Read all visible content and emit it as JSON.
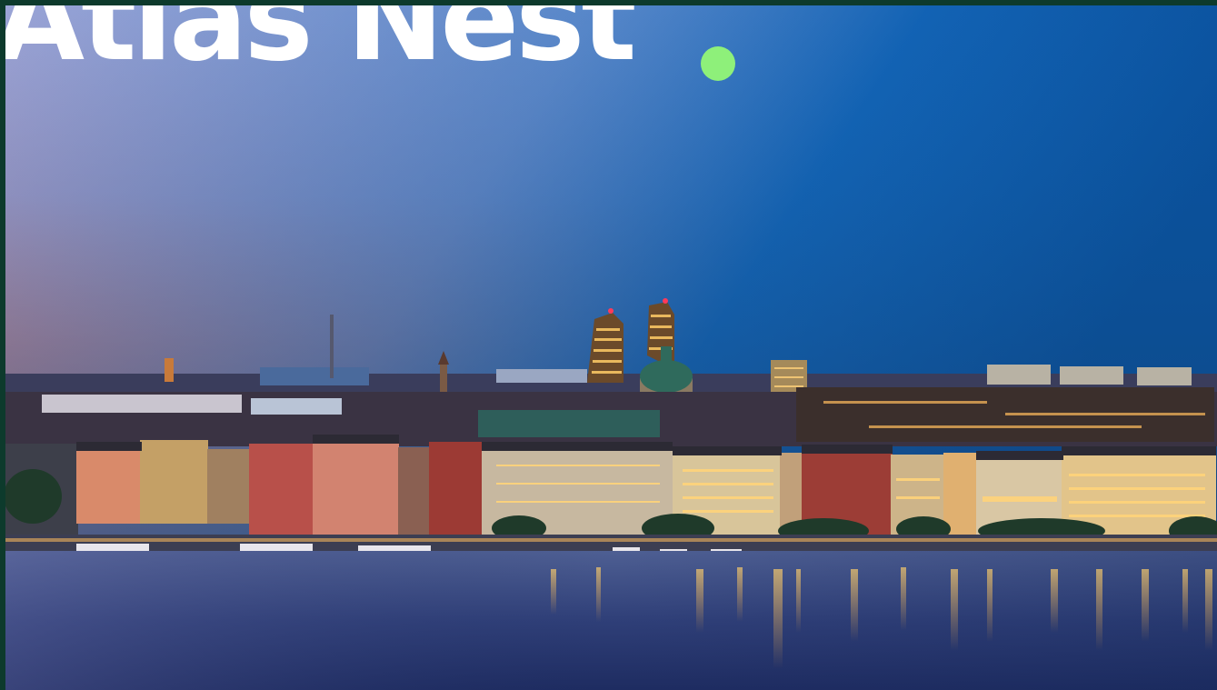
{
  "brand": {
    "name": "Atlas Nest",
    "dot_color": "#8ef07a",
    "text_color": "#ffffff"
  },
  "frame": {
    "border_color": "#0d3a2c"
  },
  "hero": {
    "subject": "city-skyline-at-dusk"
  }
}
